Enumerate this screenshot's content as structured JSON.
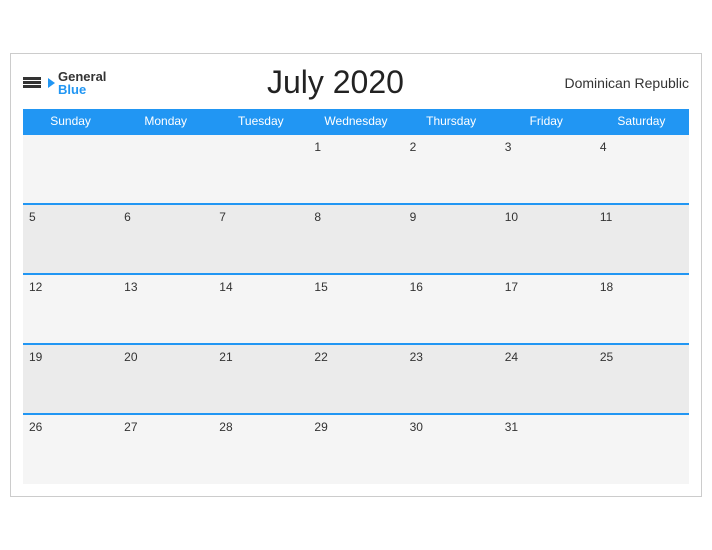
{
  "header": {
    "logo_general": "General",
    "logo_blue": "Blue",
    "title": "July 2020",
    "country": "Dominican Republic"
  },
  "days_of_week": [
    "Sunday",
    "Monday",
    "Tuesday",
    "Wednesday",
    "Thursday",
    "Friday",
    "Saturday"
  ],
  "weeks": [
    [
      "",
      "",
      "",
      "1",
      "2",
      "3",
      "4"
    ],
    [
      "5",
      "6",
      "7",
      "8",
      "9",
      "10",
      "11"
    ],
    [
      "12",
      "13",
      "14",
      "15",
      "16",
      "17",
      "18"
    ],
    [
      "19",
      "20",
      "21",
      "22",
      "23",
      "24",
      "25"
    ],
    [
      "26",
      "27",
      "28",
      "29",
      "30",
      "31",
      ""
    ]
  ]
}
